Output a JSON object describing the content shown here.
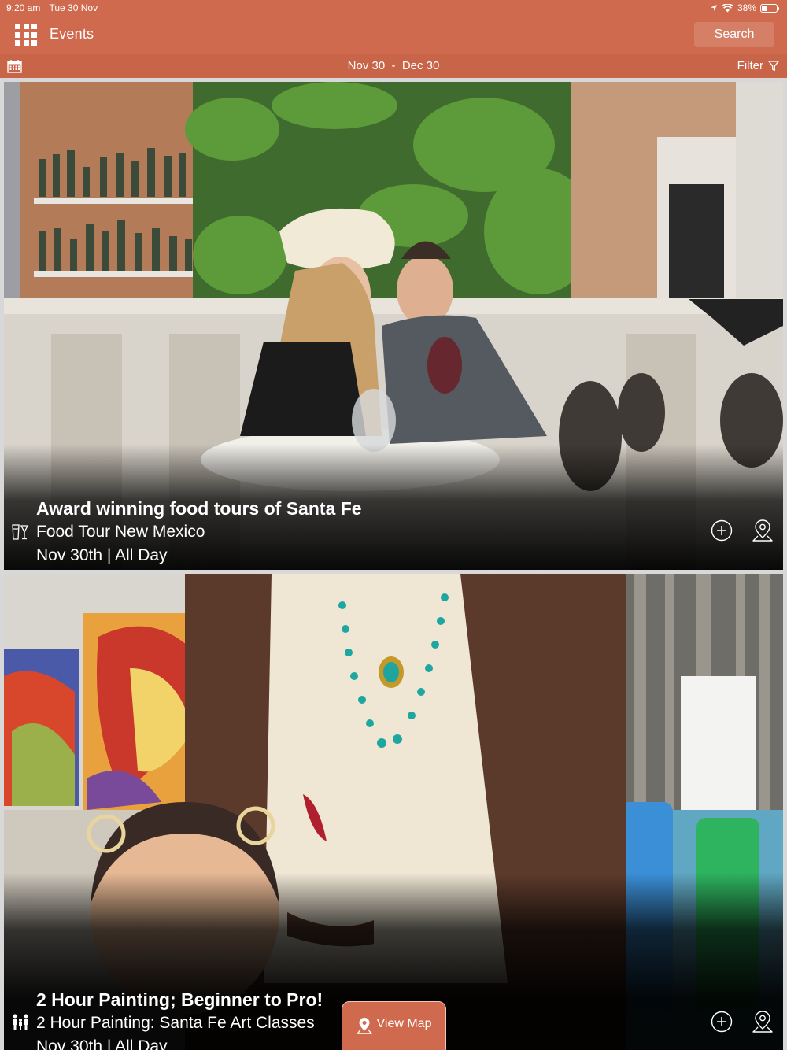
{
  "status_bar": {
    "time": "9:20 am",
    "date": "Tue 30 Nov",
    "battery": "38%",
    "battery_level": 0.38
  },
  "nav": {
    "title": "Events",
    "search_label": "Search"
  },
  "sub_bar": {
    "date_range": "Nov 30  -  Dec 30",
    "filter_label": "Filter"
  },
  "events": [
    {
      "title": "Award winning food tours of Santa Fe",
      "venue": "Food Tour New Mexico",
      "date": "Nov 30th | All Day",
      "category_icon": "food-drink-icon"
    },
    {
      "title": "2 Hour Painting; Beginner to Pro!",
      "venue": "2 Hour Painting: Santa Fe Art Classes",
      "date": "Nov 30th | All Day",
      "category_icon": "family-icon"
    }
  ],
  "view_map": {
    "label": "View Map"
  },
  "colors": {
    "brand": "#d06a4e",
    "sub_bar": "#c86448"
  }
}
